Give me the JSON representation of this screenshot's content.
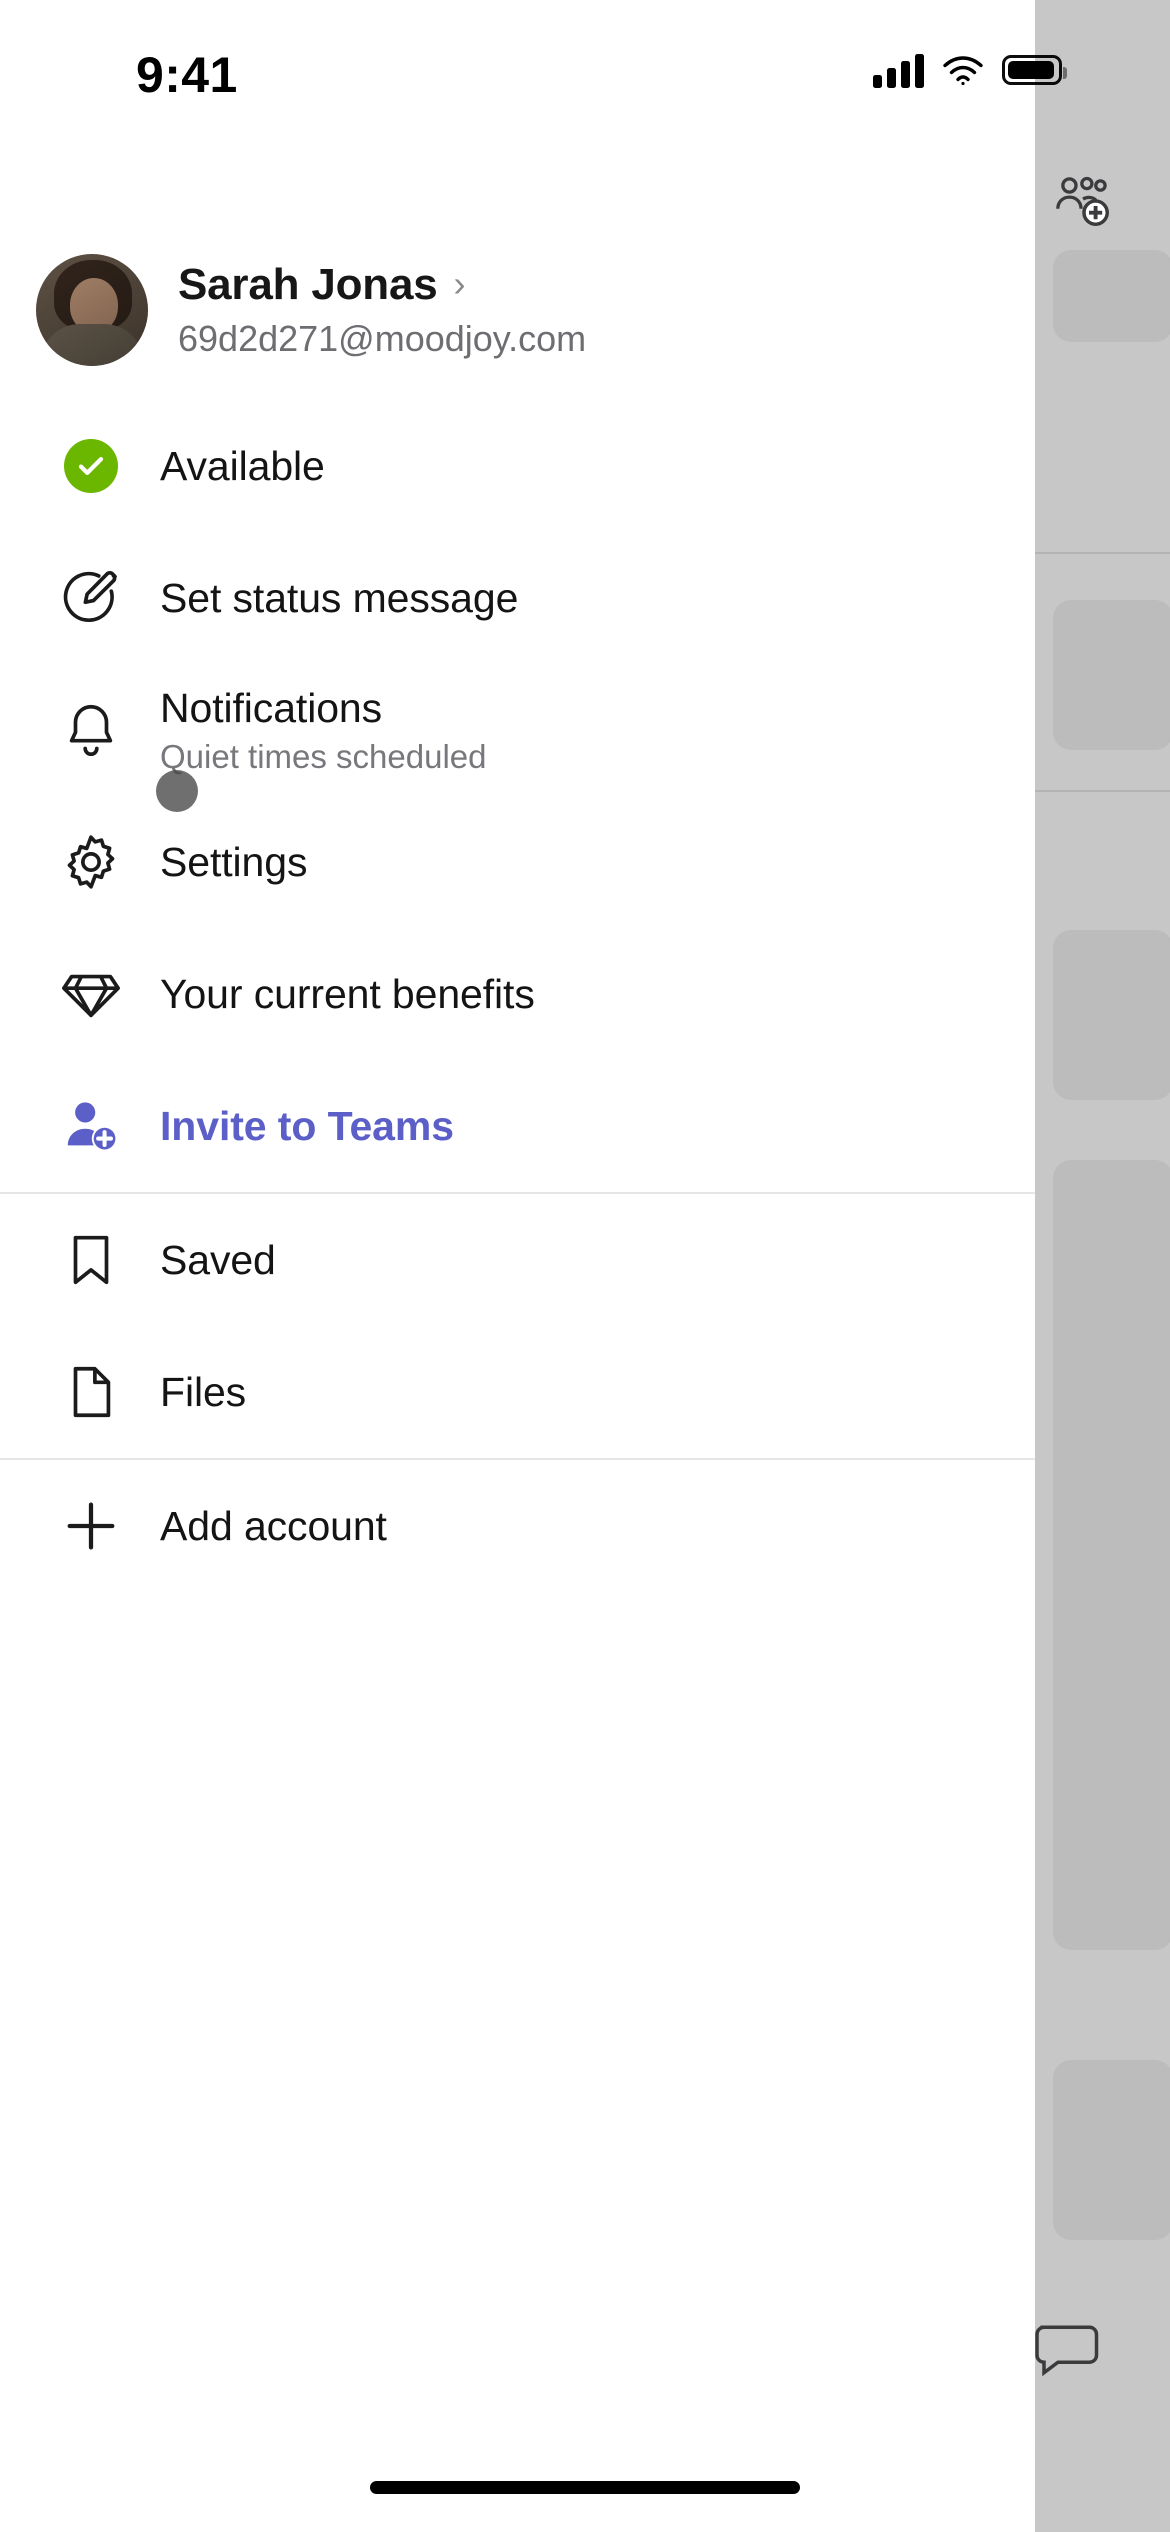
{
  "status_bar": {
    "time": "9:41",
    "cellular_icon": "signal-bars-icon",
    "wifi_icon": "wifi-icon",
    "battery_icon": "battery-icon"
  },
  "background": {
    "people_add_icon": "people-add-icon",
    "chat_bubble_icon": "chat-bubble-icon"
  },
  "profile": {
    "avatar_icon": "avatar",
    "name": "Sarah Jonas",
    "email": "69d2d271@moodjoy.com",
    "chevron_icon": "chevron-right-icon"
  },
  "menu": {
    "groups": [
      {
        "items": [
          {
            "icon": "available-check-icon",
            "label": "Available",
            "sub": ""
          },
          {
            "icon": "pencil-circle-icon",
            "label": "Set status message",
            "sub": ""
          },
          {
            "icon": "bell-icon",
            "label": "Notifications",
            "sub": "Quiet times scheduled"
          },
          {
            "icon": "gear-icon",
            "label": "Settings",
            "sub": ""
          },
          {
            "icon": "diamond-icon",
            "label": "Your current benefits",
            "sub": ""
          },
          {
            "icon": "person-add-icon",
            "label": "Invite to Teams",
            "sub": ""
          }
        ]
      },
      {
        "items": [
          {
            "icon": "bookmark-icon",
            "label": "Saved",
            "sub": ""
          },
          {
            "icon": "file-icon",
            "label": "Files",
            "sub": ""
          }
        ]
      },
      {
        "items": [
          {
            "icon": "plus-icon",
            "label": "Add account",
            "sub": ""
          }
        ]
      }
    ]
  },
  "colors": {
    "accent": "#5b5fc7",
    "available_green": "#6bb700",
    "text_primary": "#141414",
    "text_secondary": "#77777c",
    "separator": "#e6e6e8",
    "scrim": "#c8c7c8"
  },
  "home_indicator": "home-indicator"
}
